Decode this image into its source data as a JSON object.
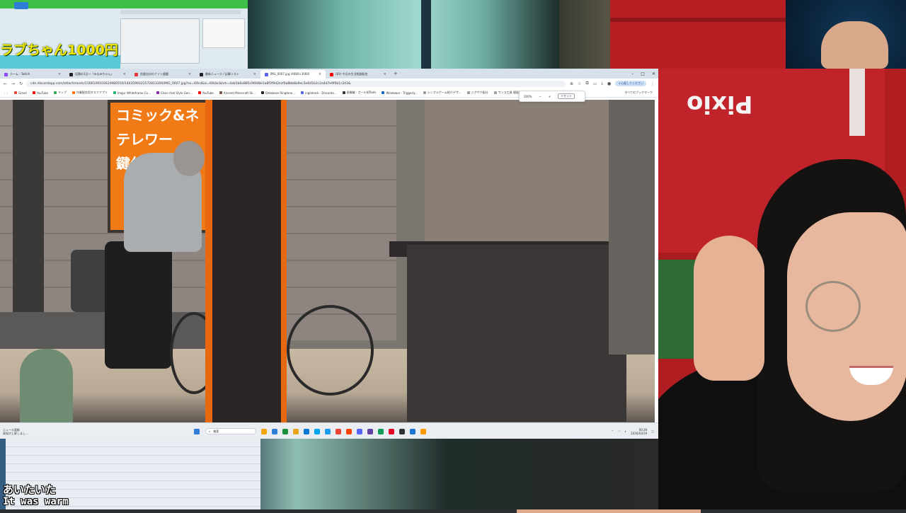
{
  "overlay": {
    "top_left_title": "ラブちゃん1000円",
    "caption_jp": "あいたいた",
    "caption_en": "It was warm",
    "box_brand": "Pixio"
  },
  "browser": {
    "tabs": [
      {
        "label": "ホーム - Twitch",
        "color": "#9146ff",
        "active": false
      },
      {
        "label": "話題の1日〜「みなみちゃん」",
        "color": "#222222",
        "active": false
      },
      {
        "label": "恋愛自分のナイト図鑑",
        "color": "#e53935",
        "active": false
      },
      {
        "label": "最新ニュース / 記事リスト",
        "color": "#222222",
        "active": false
      },
      {
        "label": "IMG_0007.jpg (4080×3060)",
        "color": "#5865f2",
        "active": true
      },
      {
        "label": "(83) 今日の生活相談配信",
        "color": "#ff0000",
        "active": false
      }
    ],
    "new_tab": "+",
    "window_controls": [
      "–",
      "□",
      "✕"
    ],
    "url": "cdn.discordapp.com/attachments/1166109103624980550/1443599101572813300/IMG_0007.jpg?ex=69cd&is=69cbc&hm=4ab5b6e885c96fd8e1a8f3f9d2ecf0a8bb8a9ec3e6d1b3c2a4d7e9f0b1c2d3&",
    "profile_button": "ぐ心配してください",
    "bookmarks": [
      {
        "label": "Gmail",
        "color": "#ea4335"
      },
      {
        "label": "YouTube",
        "color": "#ff0000"
      },
      {
        "label": "マップ",
        "color": "#34a853"
      },
      {
        "label": "作業配信用タスクアプリ",
        "color": "#ff6f00"
      },
      {
        "label": "Imgur Whiteframe Co...",
        "color": "#1bb76e"
      },
      {
        "label": "Chan chat Style Gen...",
        "color": "#8e24aa"
      },
      {
        "label": "YouTube",
        "color": "#ff0000"
      },
      {
        "label": "Ancient Minecraft Sk...",
        "color": "#795548"
      },
      {
        "label": "Database Ringtone...",
        "color": "#222222"
      },
      {
        "label": "ingleheck - Discordo...",
        "color": "#5865f2"
      },
      {
        "label": "画像編 - ガール知Tools",
        "color": "#333333"
      },
      {
        "label": "Windower - Triggerly...",
        "color": "#1565c0"
      },
      {
        "label": "シングルゲーム紹介デザ...",
        "color": "#9e9e9e"
      },
      {
        "label": "ジグザク配分",
        "color": "#9e9e9e"
      },
      {
        "label": "ワンコ工具 値段管理 日本語化",
        "color": "#9e9e9e"
      }
    ],
    "all_bookmarks": "すべてのブックマーク",
    "zoom": {
      "value": "200%",
      "minus": "−",
      "plus": "+",
      "reset": "リセット"
    }
  },
  "photo": {
    "sign_lines": [
      "コミック&ネ",
      "テレワー",
      "鍵付"
    ]
  },
  "taskbar": {
    "news_title": "ニュース速報",
    "news_sub": "高知が上昇しまし...",
    "search_placeholder": "検索",
    "apps": [
      "#f0a500",
      "#2f7fd8",
      "#1b8f3a",
      "#e8a317",
      "#0078d4",
      "#00a4ef",
      "#1d9bf0",
      "#ea4335",
      "#ff4500",
      "#5865f2",
      "#6441a5",
      "#0f9d58",
      "#e60023",
      "#333333",
      "#1976d2",
      "#ff9800"
    ],
    "time": "00:29",
    "date": "2026/03/19"
  },
  "colors": {
    "accent": "#2f7fd8",
    "sign_orange": "#ef7a16",
    "title_yellow": "#f2e600"
  }
}
